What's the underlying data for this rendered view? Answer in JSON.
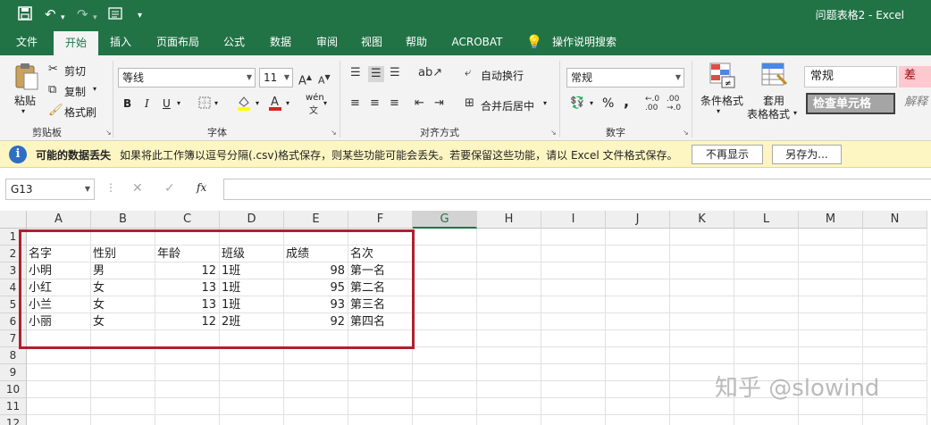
{
  "app": {
    "title": "问题表格2  -  Excel",
    "qa_icons": [
      "save-icon",
      "undo-icon",
      "redo-icon",
      "form-icon",
      "customize-icon"
    ]
  },
  "tabs": [
    "文件",
    "开始",
    "插入",
    "页面布局",
    "公式",
    "数据",
    "审阅",
    "视图",
    "帮助",
    "ACROBAT",
    "操作说明搜索"
  ],
  "ribbon": {
    "clipboard": {
      "paste": "粘贴",
      "cut": "剪切",
      "copy": "复制",
      "format_painter": "格式刷",
      "label": "剪贴板"
    },
    "font": {
      "name": "等线",
      "size": "11",
      "bold": "B",
      "italic": "I",
      "underline": "U",
      "wen": "wén",
      "label": "字体"
    },
    "alignment": {
      "wrap": "自动换行",
      "merge": "合并后居中",
      "label": "对齐方式"
    },
    "number": {
      "format": "常规",
      "percent": "%",
      "comma": ",",
      "label": "数字"
    },
    "styles": {
      "conditional": "条件格式",
      "table_l1": "套用",
      "table_l2": "表格格式",
      "normal": "常规",
      "bad": "差",
      "check_cell": "检查单元格",
      "explain": "解释"
    }
  },
  "message_bar": {
    "title": "可能的数据丢失",
    "text": "如果将此工作簿以逗号分隔(.csv)格式保存，则某些功能可能会丢失。若要保留这些功能，请以 Excel 文件格式保存。",
    "dismiss": "不再显示",
    "save_as": "另存为..."
  },
  "formula_bar": {
    "name_box": "G13",
    "cancel": "✕",
    "enter": "✓",
    "fx": "fx",
    "value": ""
  },
  "columns": [
    "A",
    "B",
    "C",
    "D",
    "E",
    "F",
    "G",
    "H",
    "I",
    "J",
    "K",
    "L",
    "M",
    "N"
  ],
  "selected_column": "G",
  "rows": [
    "1",
    "2",
    "3",
    "4",
    "5",
    "6",
    "7",
    "8",
    "9",
    "10",
    "11",
    "12"
  ],
  "sheet": {
    "header": [
      "名字",
      "性别",
      "年龄",
      "班级",
      "成绩",
      "名次"
    ],
    "data": [
      [
        "小明",
        "男",
        "12",
        "1班",
        "98",
        "第一名"
      ],
      [
        "小红",
        "女",
        "13",
        "1班",
        "95",
        "第二名"
      ],
      [
        "小兰",
        "女",
        "13",
        "1班",
        "93",
        "第三名"
      ],
      [
        "小丽",
        "女",
        "12",
        "2班",
        "92",
        "第四名"
      ]
    ]
  },
  "watermark": "知乎 @slowind",
  "colors": {
    "excel_green": "#217346",
    "highlight_red": "#b0202e",
    "message_bg": "#fdf6c3",
    "bad_style_bg": "#ffc7ce"
  }
}
